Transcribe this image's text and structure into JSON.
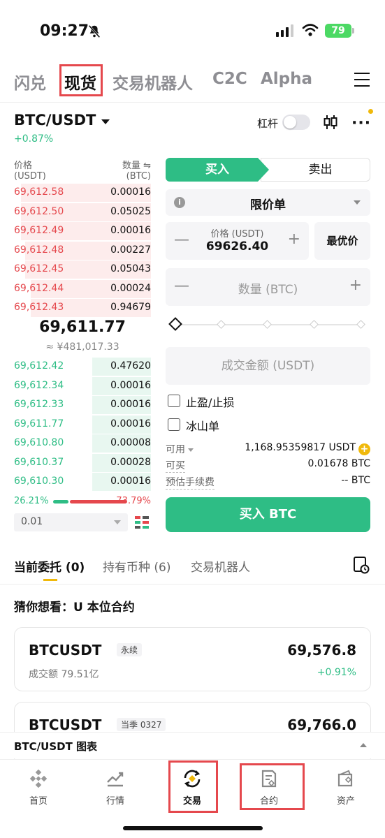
{
  "status_bar": {
    "time": "09:27",
    "battery": "79"
  },
  "top_tabs": [
    {
      "label": "闪兑"
    },
    {
      "label": "现货"
    },
    {
      "label": "交易机器人"
    },
    {
      "label": "C2C"
    },
    {
      "label": "Alpha"
    }
  ],
  "pair": {
    "name": "BTC/USDT",
    "change": "+0.87%",
    "leverage_label": "杠杆"
  },
  "orderbook": {
    "price_header": "价格",
    "price_unit": "(USDT)",
    "qty_header": "数量 ⇋",
    "qty_unit": "(BTC)",
    "asks": [
      {
        "price": "69,612.58",
        "qty": "0.00016",
        "depth": 0.95
      },
      {
        "price": "69,612.50",
        "qty": "0.05025",
        "depth": 0.95
      },
      {
        "price": "69,612.49",
        "qty": "0.00016",
        "depth": 0.95
      },
      {
        "price": "69,612.48",
        "qty": "0.00227",
        "depth": 0.92
      },
      {
        "price": "69,612.45",
        "qty": "0.05043",
        "depth": 0.92
      },
      {
        "price": "69,612.44",
        "qty": "0.00024",
        "depth": 0.88
      },
      {
        "price": "69,612.43",
        "qty": "0.94679",
        "depth": 0.88
      }
    ],
    "last_price": "69,611.77",
    "last_price_cny": "≈ ¥481,017.33",
    "bids": [
      {
        "price": "69,612.42",
        "qty": "0.47620",
        "depth": 0.43
      },
      {
        "price": "69,612.34",
        "qty": "0.00016",
        "depth": 0.43
      },
      {
        "price": "69,612.33",
        "qty": "0.00016",
        "depth": 0.43
      },
      {
        "price": "69,611.77",
        "qty": "0.00016",
        "depth": 0.43
      },
      {
        "price": "69,610.80",
        "qty": "0.00008",
        "depth": 0.43
      },
      {
        "price": "69,610.37",
        "qty": "0.00028",
        "depth": 0.43
      },
      {
        "price": "69,610.30",
        "qty": "0.00016",
        "depth": 0.43
      }
    ],
    "buy_ratio": "26.21%",
    "sell_ratio": "73.79%",
    "precision": "0.01"
  },
  "order_form": {
    "buy_tab": "买入",
    "sell_tab": "卖出",
    "order_type": "限价单",
    "price_label": "价格 (USDT)",
    "price_value": "69626.40",
    "best_price": "最优价",
    "qty_placeholder": "数量 (BTC)",
    "total_placeholder": "成交金额 (USDT)",
    "tp_sl": "止盈/止损",
    "iceberg": "冰山单",
    "available_label": "可用",
    "available_value": "1,168.95359817 USDT",
    "can_buy_label": "可买",
    "can_buy_value": "0.01678 BTC",
    "fee_label": "预估手续费",
    "fee_value": "-- BTC",
    "submit": "买入 BTC"
  },
  "bottom_tabs": {
    "open_orders": "当前委托 (0)",
    "holdings": "持有币种 (6)",
    "bots": "交易机器人"
  },
  "suggestion": {
    "title": "猜你想看：U 本位合约",
    "cards": [
      {
        "symbol": "BTCUSDT",
        "tag": "永续",
        "volume": "成交额 79.51亿",
        "price": "69,576.8",
        "change": "+0.91%"
      },
      {
        "symbol": "BTCUSDT",
        "tag": "当季 0327",
        "price": "69,766.0"
      }
    ]
  },
  "chart_bar": {
    "label": "BTC/USDT 图表"
  },
  "nav": [
    {
      "label": "首页",
      "icon": "home-icon"
    },
    {
      "label": "行情",
      "icon": "markets-icon"
    },
    {
      "label": "交易",
      "icon": "trade-icon"
    },
    {
      "label": "合约",
      "icon": "futures-icon"
    },
    {
      "label": "资产",
      "icon": "wallet-icon"
    }
  ],
  "colors": {
    "buy": "#2ebd85",
    "sell": "#e5484d",
    "accent": "#f0b90b",
    "highlight_box": "#e5484d"
  }
}
